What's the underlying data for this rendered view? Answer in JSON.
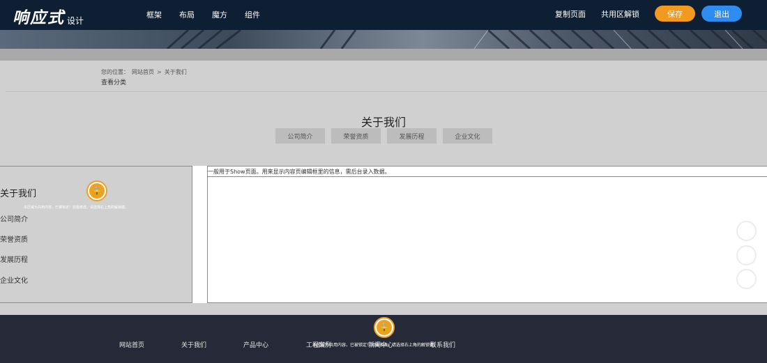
{
  "topbar": {
    "logo_main": "响应式",
    "logo_sub": "设计",
    "nav": [
      "框架",
      "布局",
      "魔方",
      "组件"
    ],
    "copy_page": "复制页面",
    "unlock_shared": "共用区解锁",
    "save_label": "保存",
    "exit_label": "退出"
  },
  "breadcrumb": {
    "location_label": "您的位置：",
    "home": "网站首页",
    "separator": ">",
    "current": "关于我们"
  },
  "view_category": "查看分类",
  "section": {
    "title": "关于我们",
    "tabs": [
      "公司简介",
      "荣誉资质",
      "发展历程",
      "企业文化"
    ]
  },
  "sidebar": {
    "title": "关于我们",
    "lock_note": "本区域为共用内容，已被锁定！如需修改，请选择右上角的解锁键。",
    "items": [
      "公司简介",
      "荣誉资质",
      "发展历程",
      "企业文化"
    ]
  },
  "content": {
    "note": "一般用于Show页面。用来显示内容页编辑框里的信息，需后台录入数据。"
  },
  "footer": {
    "nav": [
      "网站首页",
      "关于我们",
      "产品中心",
      "工程案例",
      "新闻中心",
      "联系我们"
    ],
    "lock_note": "本区域为共用内容，已被锁定！如需修改，请选择右上角的解锁键。"
  },
  "colors": {
    "topbar_bg": "#0f1f33",
    "save_button": "#f29a1f",
    "exit_button": "#2e8cf0",
    "footer_bg": "#262a38",
    "lock_accent": "#f0a020"
  }
}
